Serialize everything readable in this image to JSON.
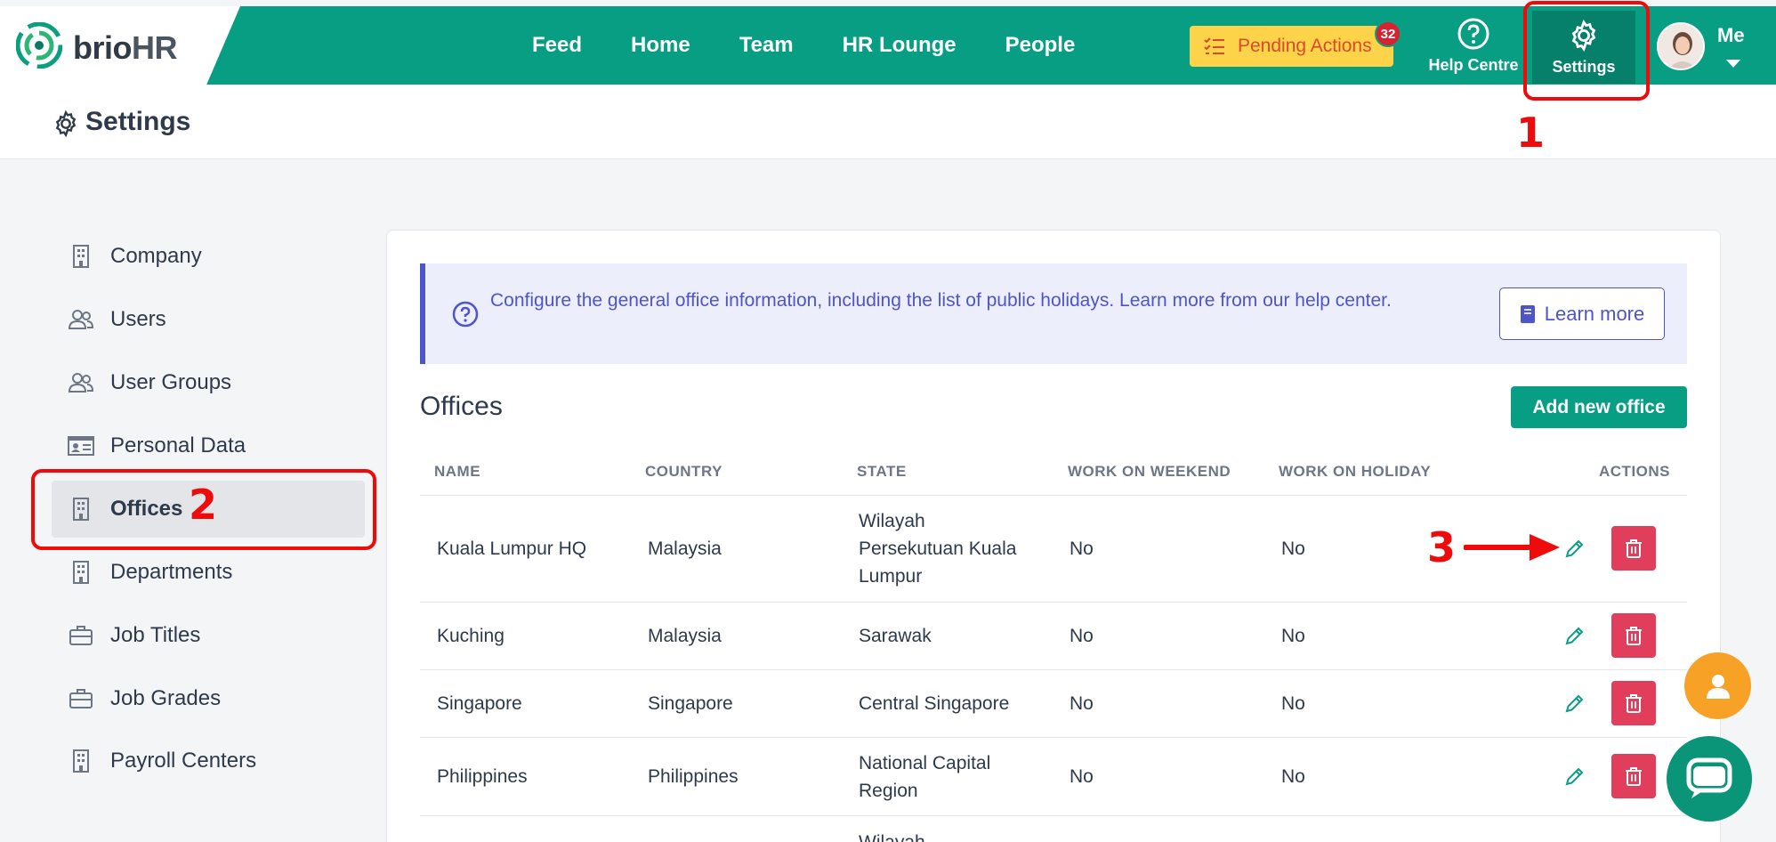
{
  "brand": {
    "logo_main": "brio",
    "logo_hr": "HR"
  },
  "nav": {
    "links": [
      "Feed",
      "Home",
      "Team",
      "HR Lounge",
      "People"
    ],
    "pending_label": "Pending Actions",
    "pending_count": "32",
    "help_label": "Help Centre",
    "settings_label": "Settings",
    "me_label": "Me"
  },
  "page": {
    "title": "Settings"
  },
  "sidebar": {
    "items": [
      {
        "label": "Company",
        "icon": "building-icon"
      },
      {
        "label": "Users",
        "icon": "users-icon"
      },
      {
        "label": "User Groups",
        "icon": "users-icon"
      },
      {
        "label": "Personal Data",
        "icon": "id-card-icon"
      },
      {
        "label": "Offices",
        "icon": "building-icon",
        "active": true
      },
      {
        "label": "Departments",
        "icon": "building-icon"
      },
      {
        "label": "Job Titles",
        "icon": "briefcase-icon"
      },
      {
        "label": "Job Grades",
        "icon": "briefcase-icon"
      },
      {
        "label": "Payroll Centers",
        "icon": "building-icon"
      }
    ]
  },
  "info": {
    "text": "Configure the general office information, including the list of public holidays. Learn more from our help center.",
    "learn_more": "Learn more"
  },
  "offices": {
    "title": "Offices",
    "add_button": "Add new office",
    "columns": [
      "NAME",
      "COUNTRY",
      "STATE",
      "WORK ON WEEKEND",
      "WORK ON HOLIDAY",
      "ACTIONS"
    ],
    "rows": [
      {
        "name": "Kuala Lumpur HQ",
        "country": "Malaysia",
        "state_lines": [
          "Wilayah",
          "Persekutuan Kuala",
          "Lumpur"
        ],
        "weekend": "No",
        "holiday": "No"
      },
      {
        "name": "Kuching",
        "country": "Malaysia",
        "state_lines": [
          "Sarawak"
        ],
        "weekend": "No",
        "holiday": "No"
      },
      {
        "name": "Singapore",
        "country": "Singapore",
        "state_lines": [
          "Central Singapore"
        ],
        "weekend": "No",
        "holiday": "No"
      },
      {
        "name": "Philippines",
        "country": "Philippines",
        "state_lines": [
          "National Capital",
          "Region"
        ],
        "weekend": "No",
        "holiday": "No"
      },
      {
        "name": "",
        "country": "",
        "state_lines": [
          "Wilayah"
        ],
        "weekend": "",
        "holiday": ""
      }
    ]
  },
  "annotations": {
    "one": "1",
    "two": "2",
    "three": "3"
  },
  "colors": {
    "brand_green": "#089e83",
    "accent_purple": "#4e55c9",
    "delete_red": "#e13e5c",
    "pending_yellow": "#fdd34a",
    "annotation_red": "#ee0b0b"
  }
}
